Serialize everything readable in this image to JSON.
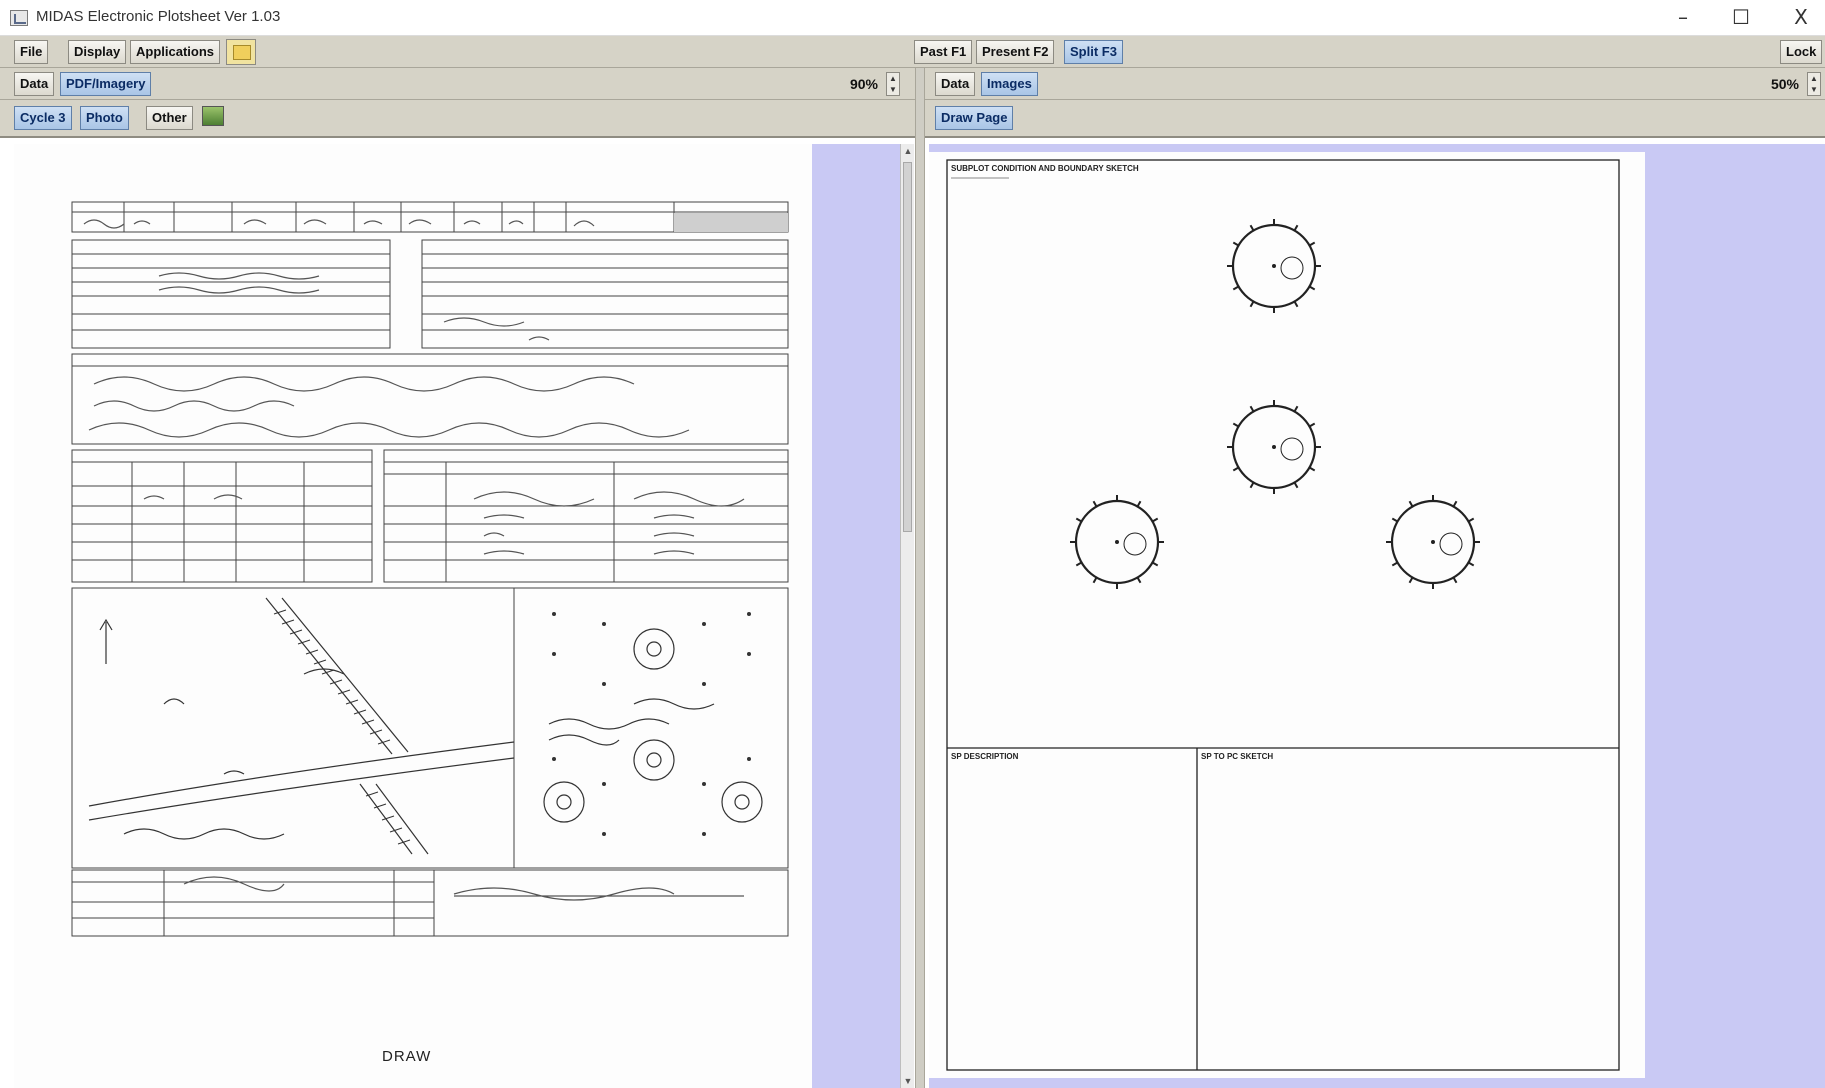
{
  "window": {
    "title": "MIDAS Electronic Plotsheet Ver 1.03",
    "minimize": "–",
    "maximize": "☐",
    "close": "X"
  },
  "menubar": {
    "file": "File",
    "display": "Display",
    "applications": "Applications",
    "past": "Past F1",
    "present": "Present F2",
    "split": "Split F3",
    "lock": "Lock"
  },
  "left_panel": {
    "tabs": [
      "Data",
      "PDF/Imagery"
    ],
    "active_tab": "PDF/Imagery",
    "zoom": "90%",
    "subtabs": [
      "Cycle 3",
      "Photo",
      "Other"
    ],
    "active_subtab": "Cycle 3",
    "document_footer": "DRAW"
  },
  "right_panel": {
    "tabs": [
      "Data",
      "Images"
    ],
    "active_tab": "Images",
    "zoom": "50%",
    "subtabs": [
      "Draw Page"
    ],
    "sheet_title": "SUBPLOT CONDITION AND BOUNDARY SKETCH",
    "box_sp_description": "SP DESCRIPTION",
    "box_sp_to_pc": "SP TO PC SKETCH"
  },
  "icons": {
    "app": "app-icon",
    "folder": "folder-icon",
    "image": "image-icon"
  },
  "colors": {
    "toolbar": "#d6d3c7",
    "viewport_bg": "#c9c9f4",
    "active_tab": "#a9c5e6"
  }
}
